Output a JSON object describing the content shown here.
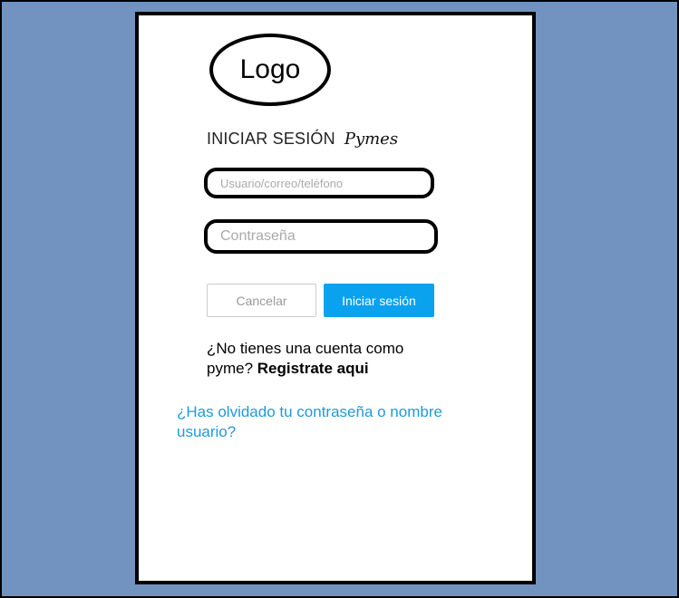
{
  "logo": {
    "text": "Logo"
  },
  "login": {
    "title": "INICIAR SESIÓN",
    "brand": "Pymes",
    "user_placeholder": "Usuario/correo/teléfono",
    "password_placeholder": "Contraseña",
    "cancel_label": "Cancelar",
    "submit_label": "Iniciar sesión",
    "register_prompt": "¿No tienes una cuenta como pyme?",
    "register_link": "Registrate aqui",
    "forgot_link": "¿Has olvidado tu contraseña o nombre usuario?"
  },
  "colors": {
    "background": "#7293c0",
    "primary": "#0aa2ef",
    "link": "#1e9bd8"
  }
}
